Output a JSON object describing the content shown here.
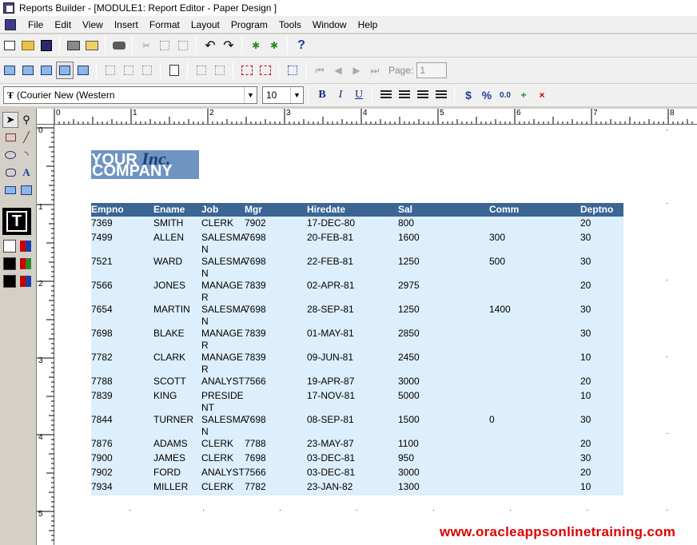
{
  "window": {
    "title": "Reports Builder - [MODULE1: Report Editor - Paper Design ]"
  },
  "menu": [
    "File",
    "Edit",
    "View",
    "Insert",
    "Format",
    "Layout",
    "Program",
    "Tools",
    "Window",
    "Help"
  ],
  "toolbar": {
    "page_label": "Page:",
    "page_value": "1"
  },
  "format_bar": {
    "font": "(Courier New (Western",
    "size": "10",
    "bold": "B",
    "italic": "I",
    "underline": "U",
    "currency": "$",
    "percent": "%",
    "decimal": "0.0"
  },
  "rulers": {
    "horizontal": [
      "0",
      "1",
      "2",
      "3",
      "4",
      "5",
      "6",
      "7",
      "8"
    ],
    "vertical": [
      "0",
      "1",
      "2",
      "3",
      "4",
      "5"
    ]
  },
  "logo": {
    "line1": "YOUR",
    "line1_italic": "Inc.",
    "line2": "COMPANY"
  },
  "report": {
    "headers": [
      "Empno",
      "Ename",
      "Job",
      "Mgr",
      "Hiredate",
      "Sal",
      "Comm",
      "Deptno"
    ],
    "rows": [
      [
        "7369",
        "SMITH",
        "CLERK",
        "7902",
        "17-DEC-80",
        "800",
        "",
        "20"
      ],
      [
        "7499",
        "ALLEN",
        "SALESMA\nN",
        "7698",
        "20-FEB-81",
        "1600",
        "300",
        "30"
      ],
      [
        "7521",
        "WARD",
        "SALESMA\nN",
        "7698",
        "22-FEB-81",
        "1250",
        "500",
        "30"
      ],
      [
        "7566",
        "JONES",
        "MANAGE\nR",
        "7839",
        "02-APR-81",
        "2975",
        "",
        "20"
      ],
      [
        "7654",
        "MARTIN",
        "SALESMA\nN",
        "7698",
        "28-SEP-81",
        "1250",
        "1400",
        "30"
      ],
      [
        "7698",
        "BLAKE",
        "MANAGE\nR",
        "7839",
        "01-MAY-81",
        "2850",
        "",
        "30"
      ],
      [
        "7782",
        "CLARK",
        "MANAGE\nR",
        "7839",
        "09-JUN-81",
        "2450",
        "",
        "10"
      ],
      [
        "7788",
        "SCOTT",
        "ANALYST",
        "7566",
        "19-APR-87",
        "3000",
        "",
        "20"
      ],
      [
        "7839",
        "KING",
        "PRESIDE\nNT",
        "",
        "17-NOV-81",
        "5000",
        "",
        "10"
      ],
      [
        "7844",
        "TURNER",
        "SALESMA\nN",
        "7698",
        "08-SEP-81",
        "1500",
        "0",
        "30"
      ],
      [
        "7876",
        "ADAMS",
        "CLERK",
        "7788",
        "23-MAY-87",
        "1100",
        "",
        "20"
      ],
      [
        "7900",
        "JAMES",
        "CLERK",
        "7698",
        "03-DEC-81",
        "950",
        "",
        "30"
      ],
      [
        "7902",
        "FORD",
        "ANALYST",
        "7566",
        "03-DEC-81",
        "3000",
        "",
        "20"
      ],
      [
        "7934",
        "MILLER",
        "CLERK",
        "7782",
        "23-JAN-82",
        "1300",
        "",
        "10"
      ]
    ]
  },
  "watermark": "www.oracleappsonlinetraining.com",
  "colors": {
    "header_bg": "#3b6593",
    "body_bg": "#ddeefc",
    "logo_bg": "#6f94c2",
    "watermark": "#e00000"
  }
}
